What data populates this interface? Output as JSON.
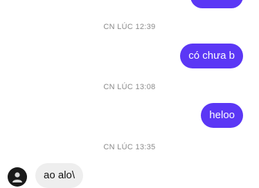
{
  "conversation": {
    "messages": [
      {
        "direction": "out",
        "text": ""
      },
      {
        "direction": "out",
        "text": "có chưa b"
      },
      {
        "direction": "out",
        "text": "heloo"
      },
      {
        "direction": "in",
        "text": "ao alo\\"
      }
    ],
    "timestamps": [
      "CN LÚC 12:39",
      "CN LÚC 13:08",
      "CN LÚC 13:35"
    ]
  },
  "colors": {
    "outgoing_bubble": "#5b37f5",
    "incoming_bubble": "#eeeeee",
    "timestamp_text": "#8a8a8a"
  },
  "icons": {
    "contact_avatar": "avatar-icon"
  }
}
